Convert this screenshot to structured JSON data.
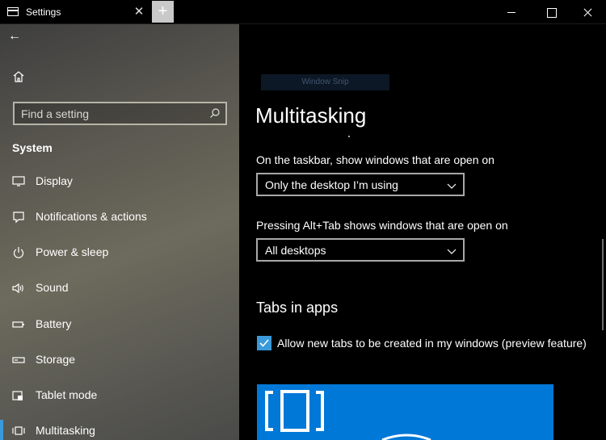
{
  "window": {
    "title": "Settings",
    "tab_close_glyph": "✕",
    "new_tab_glyph": "+",
    "controls": [
      "minimize",
      "maximize",
      "close"
    ]
  },
  "sidebar": {
    "back_glyph": "←",
    "search": {
      "placeholder": "Find a setting",
      "value": ""
    },
    "section_title": "System",
    "items": [
      {
        "label": "Display",
        "icon": "display-icon",
        "selected": false
      },
      {
        "label": "Notifications & actions",
        "icon": "notifications-icon",
        "selected": false
      },
      {
        "label": "Power & sleep",
        "icon": "power-icon",
        "selected": false
      },
      {
        "label": "Sound",
        "icon": "sound-icon",
        "selected": false
      },
      {
        "label": "Battery",
        "icon": "battery-icon",
        "selected": false
      },
      {
        "label": "Storage",
        "icon": "storage-icon",
        "selected": false
      },
      {
        "label": "Tablet mode",
        "icon": "tablet-mode-icon",
        "selected": false
      },
      {
        "label": "Multitasking",
        "icon": "multitasking-icon",
        "selected": true
      }
    ]
  },
  "main": {
    "snip_tag": "Window Snip",
    "title": "Multitasking",
    "taskbar_setting": {
      "label": "On the taskbar, show windows that are open on",
      "value": "Only the desktop I’m using"
    },
    "alttab_setting": {
      "label": "Pressing Alt+Tab shows windows that are open on",
      "value": "All desktops"
    },
    "tabs_section_title": "Tabs in apps",
    "tabs_checkbox": {
      "label": "Allow new tabs to be created in my windows (preview feature)",
      "checked": true
    }
  },
  "colors": {
    "accent": "#3a9ad9",
    "preview_bg": "#0078d7",
    "background": "#000000"
  }
}
